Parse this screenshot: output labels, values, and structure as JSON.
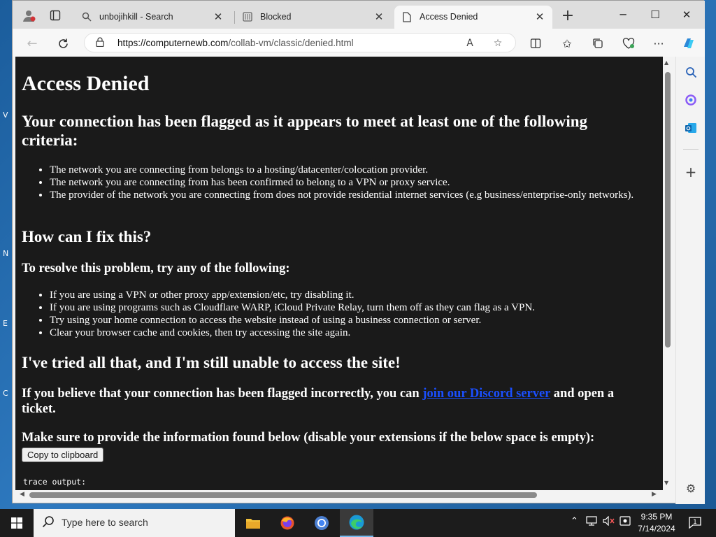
{
  "browser": {
    "tabs": [
      {
        "title": "unbojihkill - Search",
        "icon": "search-icon"
      },
      {
        "title": "Blocked",
        "icon": "page-icon"
      },
      {
        "title": "Access Denied",
        "icon": "document-icon"
      }
    ],
    "url_domain": "https://computernewb.com",
    "url_path": "/collab-vm/classic/denied.html"
  },
  "page": {
    "title": "Access Denied",
    "flagged_heading": "Your connection has been flagged as it appears to meet at least one of the following criteria:",
    "criteria": [
      "The network you are connecting from belongs to a hosting/datacenter/colocation provider.",
      "The network you are connecting from has been confirmed to belong to a VPN or proxy service.",
      "The provider of the network you are connecting from does not provide residential internet services (e.g business/enterprise-only networks)."
    ],
    "fix_heading": "How can I fix this?",
    "resolve_heading": "To resolve this problem, try any of the following:",
    "fixes": [
      "If you are using a VPN or other proxy app/extension/etc, try disabling it.",
      "If you are using programs such as Cloudflare WARP, iCloud Private Relay, turn them off as they can flag as a VPN.",
      "Try using your home connection to access the website instead of using a business connection or server.",
      "Clear your browser cache and cookies, then try accessing the site again."
    ],
    "tried_heading": "I've tried all that, and I'm still unable to access the site!",
    "incorrect_prefix": "If you believe that your connection has been flagged incorrectly, you can ",
    "discord_link": "join our Discord server",
    "incorrect_suffix": " and open a ticket.",
    "info_heading": "Make sure to provide the information found below (disable your extensions if the below space is empty):",
    "copy_button": "Copy to clipboard",
    "trace_label": "trace output:"
  },
  "taskbar": {
    "search_placeholder": "Type here to search",
    "time": "9:35 PM",
    "date": "7/14/2024"
  },
  "colors": {
    "page_background": "#1a1a1a",
    "link": "#1a4fff",
    "taskbar": "#1c1c1c"
  }
}
